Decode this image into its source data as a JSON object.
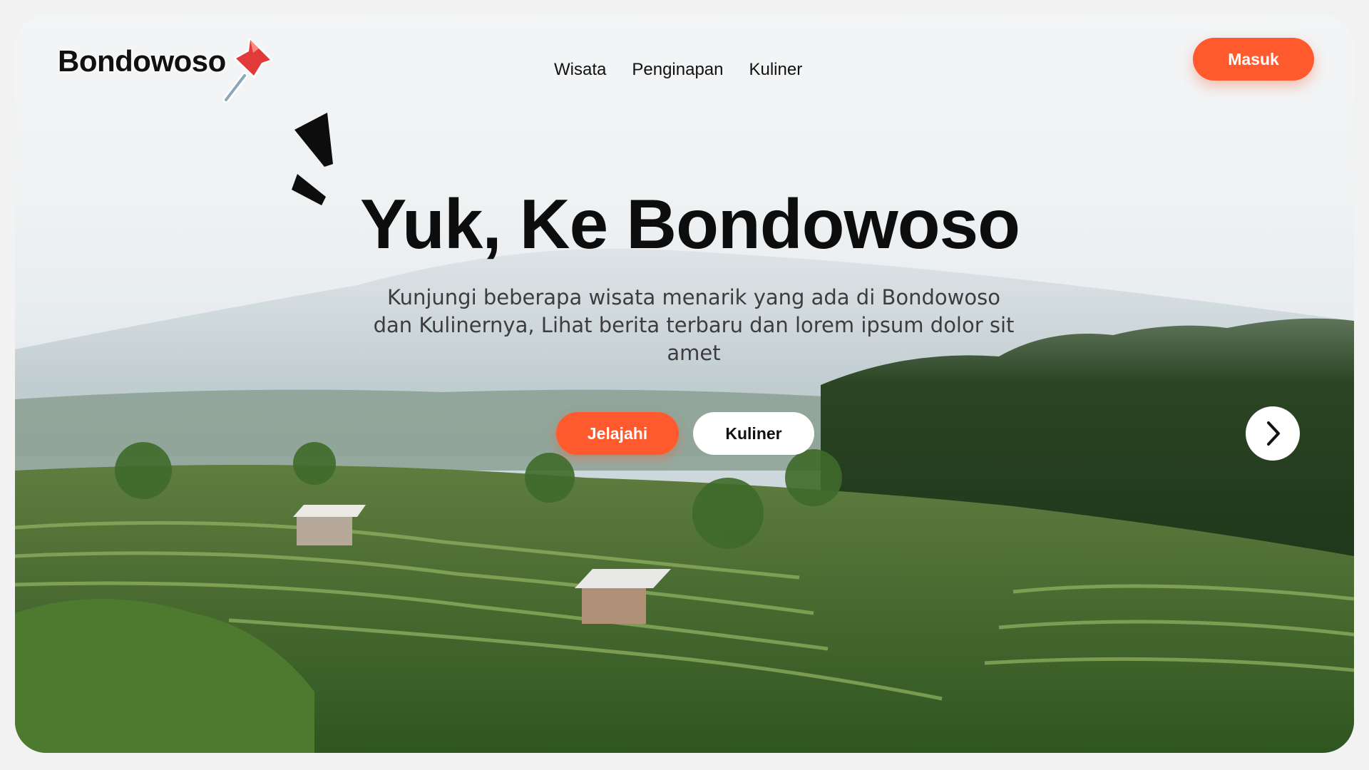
{
  "brand": {
    "name": "Bondowoso",
    "pin_icon": "pushpin-icon",
    "accent": "#ff5a2e"
  },
  "nav": {
    "links": [
      "Wisata",
      "Penginapan",
      "Kuliner"
    ],
    "login_label": "Masuk"
  },
  "hero": {
    "decor_icon": "spark-lines-icon",
    "title": "Yuk, Ke Bondowoso",
    "subtitle": "Kunjungi beberapa wisata menarik yang ada di Bondowoso dan Kulinernya, Lihat berita terbaru dan lorem ipsum dolor sit amet",
    "primary_cta": "Jelajahi",
    "secondary_cta": "Kuliner",
    "next_icon": "chevron-right-icon"
  },
  "colors": {
    "accent": "#ff5a2e",
    "text": "#0d0d0d",
    "background": "#f2f2f2"
  }
}
